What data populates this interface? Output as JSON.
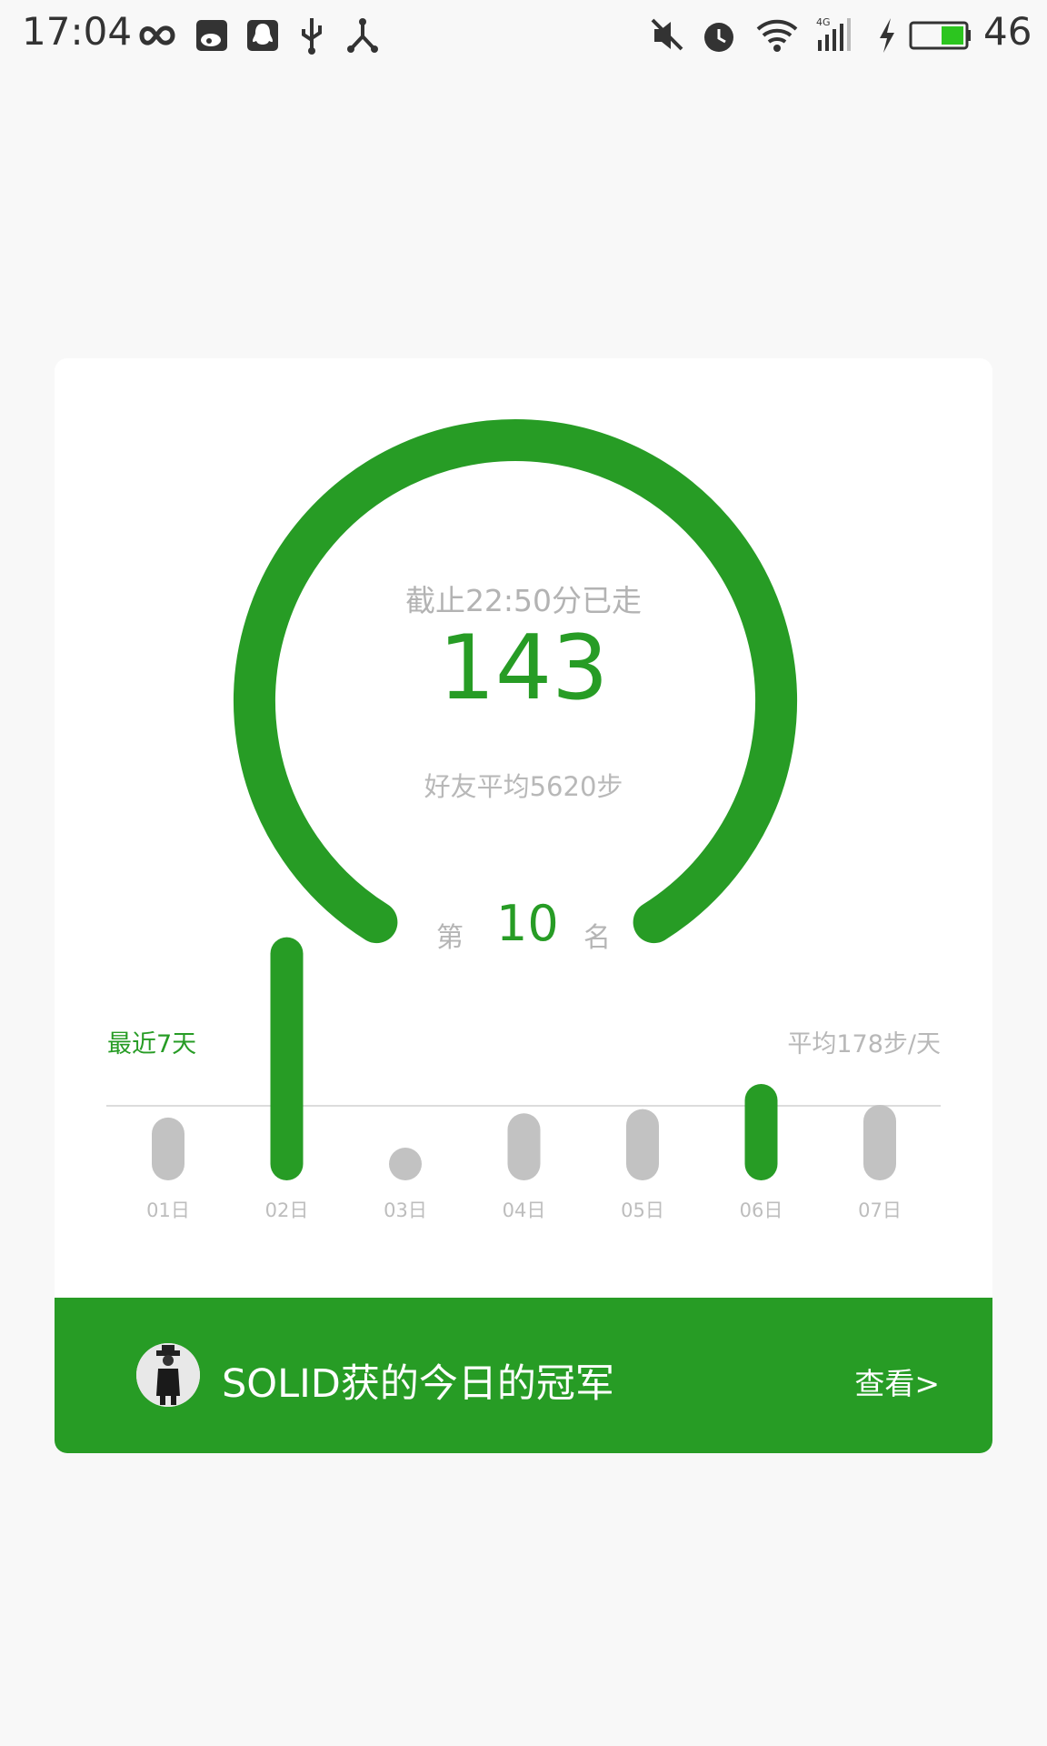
{
  "status_bar": {
    "time": "17:04",
    "battery_level": "46",
    "left_icons": [
      "infinity-icon",
      "weibo-icon",
      "qq-icon",
      "usb-icon",
      "share-icon"
    ],
    "right_icons": [
      "mute-icon",
      "alarm-icon",
      "wifi-icon",
      "signal-4g-icon",
      "charging-icon",
      "battery-icon"
    ]
  },
  "ring": {
    "caption": "截止22:50分已走",
    "value": "143",
    "friends_avg": "好友平均5620步",
    "rank_prefix": "第",
    "rank_num": "10",
    "rank_suffix": "名"
  },
  "weekly": {
    "label": "最近7天",
    "average": "平均178步/天",
    "chart_data": {
      "type": "bar",
      "categories": [
        "01日",
        "02日",
        "03日",
        "04日",
        "05日",
        "06日",
        "07日"
      ],
      "values": [
        150,
        580,
        60,
        160,
        170,
        230,
        180
      ],
      "average": 178,
      "highlight": [
        false,
        true,
        false,
        false,
        false,
        true,
        false
      ],
      "colors": {
        "normal": "#c2c2c2",
        "highlight": "#279c25",
        "avgline": "#dcdcdc"
      }
    }
  },
  "banner": {
    "text": "SOLID获的今日的冠军",
    "link": "查看>"
  },
  "colors": {
    "accent": "#279c25",
    "background": "#f8f8f8",
    "card": "#ffffff",
    "muted_text": "#b8b8b8"
  }
}
